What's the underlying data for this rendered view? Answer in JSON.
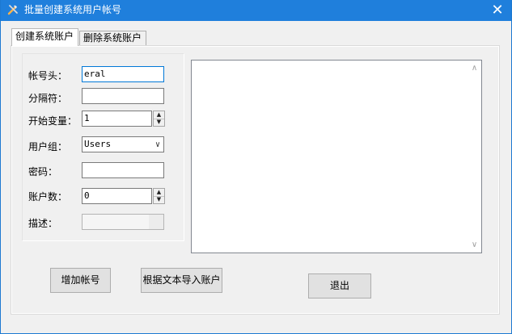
{
  "window": {
    "title": "批量创建系统用户帐号",
    "close_glyph": "✕",
    "accent": "#1f7fdc"
  },
  "tabs": [
    {
      "label": "创建系统账户",
      "active": true
    },
    {
      "label": "删除系统账户",
      "active": false
    }
  ],
  "form": {
    "account_prefix": {
      "label": "帐号头：",
      "value": "eral"
    },
    "separator": {
      "label": "分隔符：",
      "value": ""
    },
    "start_variable": {
      "label": "开始变量：",
      "value": "1"
    },
    "user_group": {
      "label": "用户组：",
      "value": "Users"
    },
    "password": {
      "label": "密码：",
      "value": ""
    },
    "account_count": {
      "label": "账户数：",
      "value": "0"
    },
    "description": {
      "label": "描述：",
      "value": ""
    }
  },
  "log": {
    "value": ""
  },
  "buttons": {
    "add": "增加帐号",
    "import": "根据文本导入账户",
    "exit": "退出"
  }
}
